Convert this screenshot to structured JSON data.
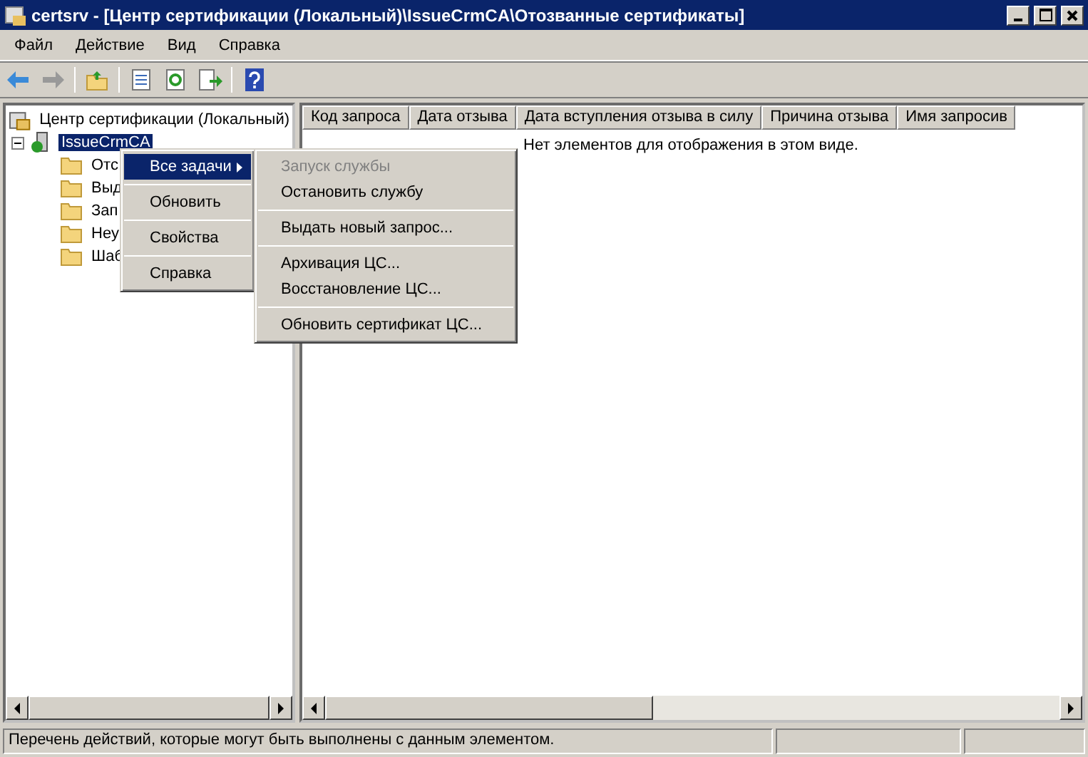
{
  "window": {
    "title": "certsrv - [Центр сертификации (Локальный)\\IssueCrmCA\\Отозванные сертификаты]"
  },
  "menu_bar": [
    "Файл",
    "Действие",
    "Вид",
    "Справка"
  ],
  "tree": {
    "label": "Центр сертификации (Локальный)",
    "children": [
      {
        "label": "IssueCrmCA",
        "selected": true,
        "expanded": true,
        "children": [
          {
            "label": "Отс"
          },
          {
            "label": "Выд"
          },
          {
            "label": "Зап"
          },
          {
            "label": "Неу"
          },
          {
            "label": "Шаб"
          }
        ]
      }
    ]
  },
  "table": {
    "columns": [
      "Код запроса",
      "Дата отзыва",
      "Дата вступления отзыва в силу",
      "Причина отзыва",
      "Имя запросив"
    ],
    "empty_message": "Нет элементов для отображения в этом виде."
  },
  "context_menu": [
    {
      "kind": "item",
      "label": "Все задачи",
      "selected": true,
      "submenu": true
    },
    {
      "kind": "separator"
    },
    {
      "kind": "item",
      "label": "Обновить",
      "selected": false,
      "submenu": false
    },
    {
      "kind": "separator"
    },
    {
      "kind": "item",
      "label": "Свойства",
      "selected": false,
      "submenu": false
    },
    {
      "kind": "separator"
    },
    {
      "kind": "item",
      "label": "Справка",
      "selected": false,
      "submenu": false
    }
  ],
  "submenu": [
    {
      "kind": "item",
      "label": "Запуск службы",
      "disabled": true
    },
    {
      "kind": "item",
      "label": "Остановить службу",
      "disabled": false
    },
    {
      "kind": "separator"
    },
    {
      "kind": "item",
      "label": "Выдать новый запрос...",
      "disabled": false
    },
    {
      "kind": "separator"
    },
    {
      "kind": "item",
      "label": "Архивация ЦС...",
      "disabled": false
    },
    {
      "kind": "item",
      "label": "Восстановление ЦС...",
      "disabled": false
    },
    {
      "kind": "separator"
    },
    {
      "kind": "item",
      "label": "Обновить сертификат ЦС...",
      "disabled": false
    }
  ],
  "status_bar": "Перечень действий, которые могут быть выполнены с данным элементом."
}
